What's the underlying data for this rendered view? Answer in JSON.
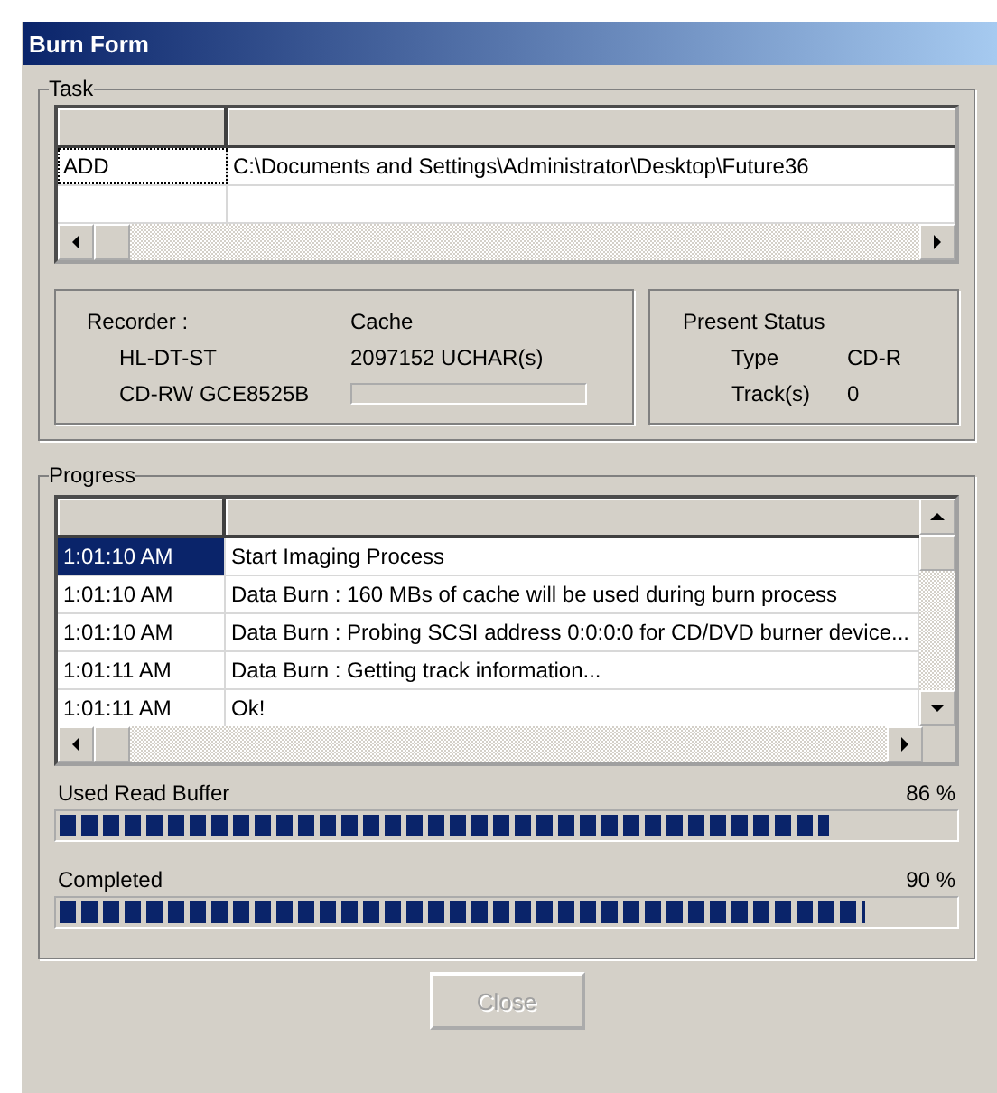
{
  "window": {
    "title": "Burn Form"
  },
  "task": {
    "label": "Task",
    "rows": [
      {
        "action": "ADD",
        "path": "C:\\Documents and Settings\\Administrator\\Desktop\\Future36",
        "selected": true
      }
    ]
  },
  "recorder": {
    "label": "Recorder :",
    "vendor": "HL-DT-ST",
    "model": "CD-RW GCE8525B",
    "cache_label": "Cache",
    "cache_value": "2097152 UCHAR(s)",
    "cache_meter": {
      "level": 0
    }
  },
  "present_status": {
    "label": "Present Status",
    "fields": [
      {
        "name": "Type",
        "value": "CD-R"
      },
      {
        "name": "Track(s)",
        "value": "0"
      }
    ]
  },
  "progress": {
    "label": "Progress",
    "log": [
      {
        "time": "1:01:10 AM",
        "message": "Start Imaging Process",
        "selected": true
      },
      {
        "time": "1:01:10 AM",
        "message": "Data Burn : 160 MBs of cache will be used during burn process",
        "selected": false
      },
      {
        "time": "1:01:10 AM",
        "message": "Data Burn : Probing SCSI address 0:0:0:0 for CD/DVD burner device...",
        "selected": false
      },
      {
        "time": "1:01:11 AM",
        "message": "Data Burn : Getting track information...",
        "selected": false
      },
      {
        "time": "1:01:11 AM",
        "message": "Ok!",
        "selected": false
      }
    ],
    "meters": [
      {
        "label": "Used Read Buffer",
        "reading": "86 %",
        "level": 0.86
      },
      {
        "label": "Completed",
        "reading": "90 %",
        "level": 0.9
      }
    ]
  },
  "buttons": [
    {
      "label": "Close",
      "disabled": true
    }
  ]
}
